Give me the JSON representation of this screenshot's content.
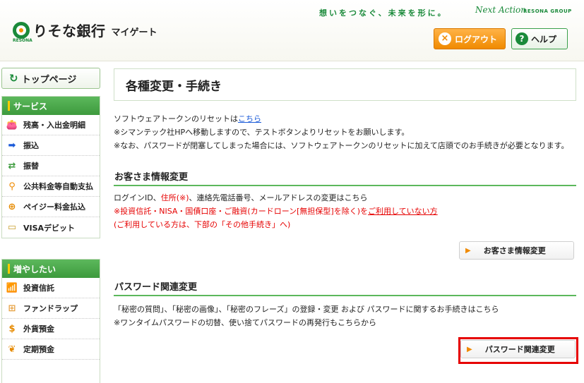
{
  "header": {
    "logo_text": "りそな銀行",
    "logo_suffix": "マイゲート",
    "logo_sub": "RESONA",
    "tagline": "想いをつなぐ、未来を形に。",
    "tagline_script": "Next Action",
    "group_name": "RESONA GROUP",
    "logout_label": "ログアウト",
    "help_label": "ヘルプ"
  },
  "sidebar": {
    "top_page_label": "トップページ",
    "service": {
      "title": "サービス",
      "items": [
        {
          "label": "残高・入出金明細",
          "icon": "wallet-icon"
        },
        {
          "label": "振込",
          "icon": "transfer-icon"
        },
        {
          "label": "振替",
          "icon": "exchange-icon"
        },
        {
          "label": "公共料金等自動支払",
          "icon": "faucet-icon"
        },
        {
          "label": "ペイジー料金払込",
          "icon": "payeasy-icon"
        },
        {
          "label": "VISAデビット",
          "icon": "card-icon"
        }
      ]
    },
    "grow": {
      "title": "増やしたい",
      "items": [
        {
          "label": "投資信託",
          "icon": "chart-icon"
        },
        {
          "label": "ファンドラップ",
          "icon": "gift-icon"
        },
        {
          "label": "外貨預金",
          "icon": "dollar-icon"
        },
        {
          "label": "定期預金",
          "icon": "bag-icon"
        }
      ]
    }
  },
  "main": {
    "title": "各種変更・手続き",
    "token": {
      "line1_prefix": "ソフトウェアトークンのリセットは",
      "line1_link": "こちら",
      "line2": "※シマンテック社HPへ移動しますので、テストボタンよりリセットをお願いします。",
      "line3": "※なお、パスワードが閉塞してしまった場合には、ソフトウェアトークンのリセットに加えて店頭でのお手続きが必要となります。"
    },
    "customer": {
      "heading": "お客さま情報変更",
      "line1_a": "ログインID、",
      "line1_red": "住所(※)",
      "line1_b": "、連絡先電話番号、メールアドレスの変更はこちら",
      "line2_red": "※投資信託・NISA・国債口座・ご融資(カードローン[無担保型]を除く)を",
      "line2_link": "ご利用していない方",
      "line3_red": "(ご利用している方は、下部の「その他手続き」へ)",
      "button_label": "お客さま情報変更"
    },
    "password": {
      "heading": "パスワード関連変更",
      "line1": "「秘密の質問」、「秘密の画像」、「秘密のフレーズ」の登録・変更 および パスワードに関するお手続きはこちら",
      "line2": "※ワンタイムパスワードの切替、使い捨てパスワードの再発行もこちらから",
      "button_label": "パスワード関連変更"
    }
  },
  "colors": {
    "brand_green": "#1a8a3a",
    "accent_orange": "#f08a00",
    "alert_red": "#e60000",
    "link_blue": "#1a5ad8"
  }
}
